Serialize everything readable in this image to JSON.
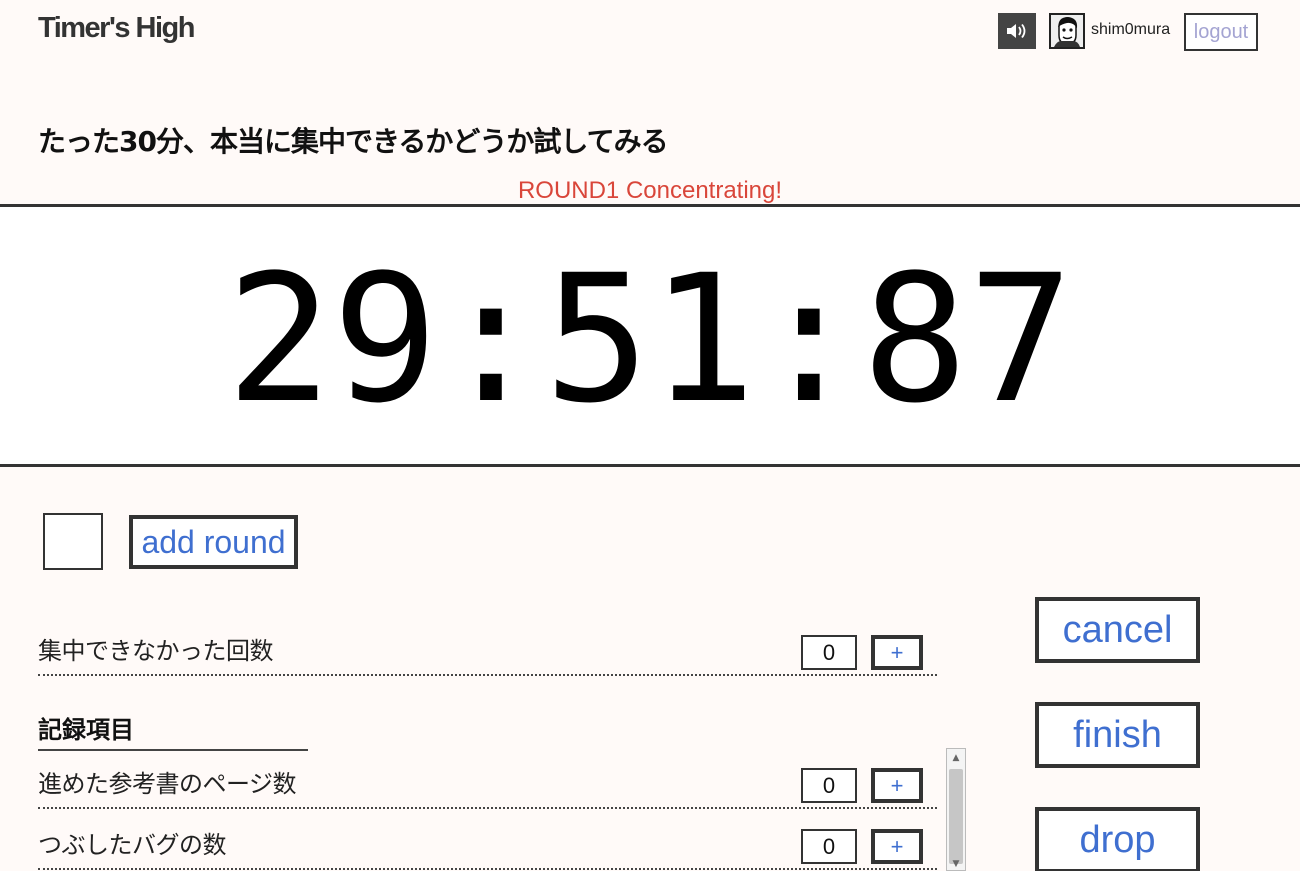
{
  "header": {
    "logo": "Timer's High",
    "username": "shim0mura",
    "logout_label": "logout",
    "sound_icon": "speaker-icon",
    "avatar_icon": "user-avatar"
  },
  "task": {
    "title": "たった30分、本当に集中できるかどうか試してみる",
    "status": "ROUND1 Concentrating!"
  },
  "timer": {
    "display": "29:51:87"
  },
  "controls": {
    "add_round_label": "add round",
    "cancel_label": "cancel",
    "finish_label": "finish",
    "drop_label": "drop"
  },
  "distraction": {
    "label": "集中できなかった回数",
    "count": "0",
    "plus_label": "+"
  },
  "records": {
    "heading": "記録項目",
    "items": [
      {
        "label": "進めた参考書のページ数",
        "count": "0",
        "plus_label": "+"
      },
      {
        "label": "つぶしたバグの数",
        "count": "0",
        "plus_label": "+"
      }
    ]
  },
  "colors": {
    "background": "#fffaf8",
    "link_blue": "#3f6fd0",
    "status_red": "#d9463a",
    "logout_text": "#a4a4d2"
  }
}
